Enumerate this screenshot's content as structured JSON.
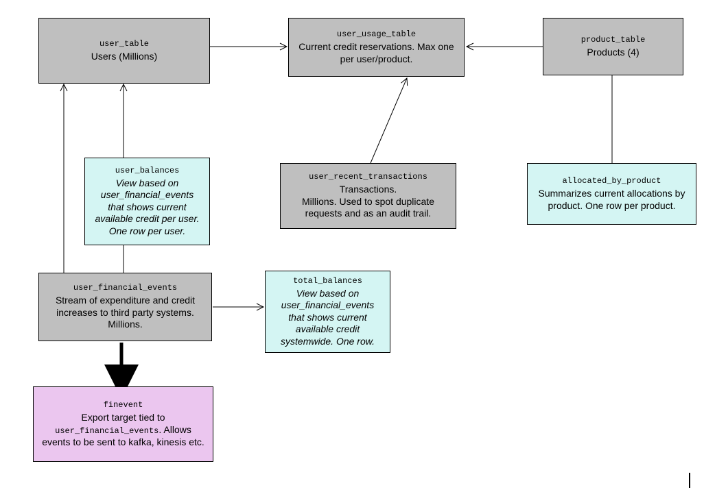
{
  "diagram": {
    "nodes": {
      "user_table": {
        "code": "user_table",
        "desc": "Users (Millions)",
        "color": "gray"
      },
      "user_usage_table": {
        "code": "user_usage_table",
        "desc": "Current credit reservations. Max one per user/product.",
        "color": "gray"
      },
      "product_table": {
        "code": "product_table",
        "desc": "Products (4)",
        "color": "gray"
      },
      "user_balances": {
        "code": "user_balances",
        "desc": "View based on user_financial_events that shows current available credit per user. One row per user.",
        "color": "cyan",
        "italic": true
      },
      "user_recent_transactions": {
        "code": "user_recent_transactions",
        "desc": "Transactions.\nMillions. Used to spot duplicate requests and as an audit trail.",
        "color": "gray"
      },
      "allocated_by_product": {
        "code": "allocated_by_product",
        "desc": "Summarizes current allocations by product. One row per product.",
        "color": "cyan"
      },
      "user_financial_events": {
        "code": "user_financial_events",
        "desc": "Stream of expenditure and credit increases to third party systems. Millions.",
        "color": "gray"
      },
      "total_balances": {
        "code": "total_balances",
        "desc": "View based on user_financial_events that shows current available credit systemwide. One row.",
        "color": "cyan",
        "italic": true
      },
      "finevent": {
        "code": "finevent",
        "desc_prefix": "Export target tied to ",
        "desc_code": "user_financial_events",
        "desc_suffix": ". Allows events to be sent to kafka, kinesis etc.",
        "color": "pink"
      }
    },
    "edges": [
      {
        "from": "user_table",
        "to": "user_usage_table"
      },
      {
        "from": "product_table",
        "to": "user_usage_table"
      },
      {
        "from": "user_recent_transactions",
        "to": "user_usage_table"
      },
      {
        "from": "user_table",
        "to": "user_financial_events"
      },
      {
        "from": "user_balances",
        "to": "user_financial_events"
      },
      {
        "from": "user_financial_events",
        "to": "total_balances"
      },
      {
        "from": "product_table",
        "to": "allocated_by_product"
      },
      {
        "from": "user_financial_events",
        "to": "finevent",
        "thick": true
      }
    ],
    "colors": {
      "gray": "#bfbfbf",
      "cyan": "#d4f5f3",
      "pink": "#ebc6ef"
    }
  }
}
